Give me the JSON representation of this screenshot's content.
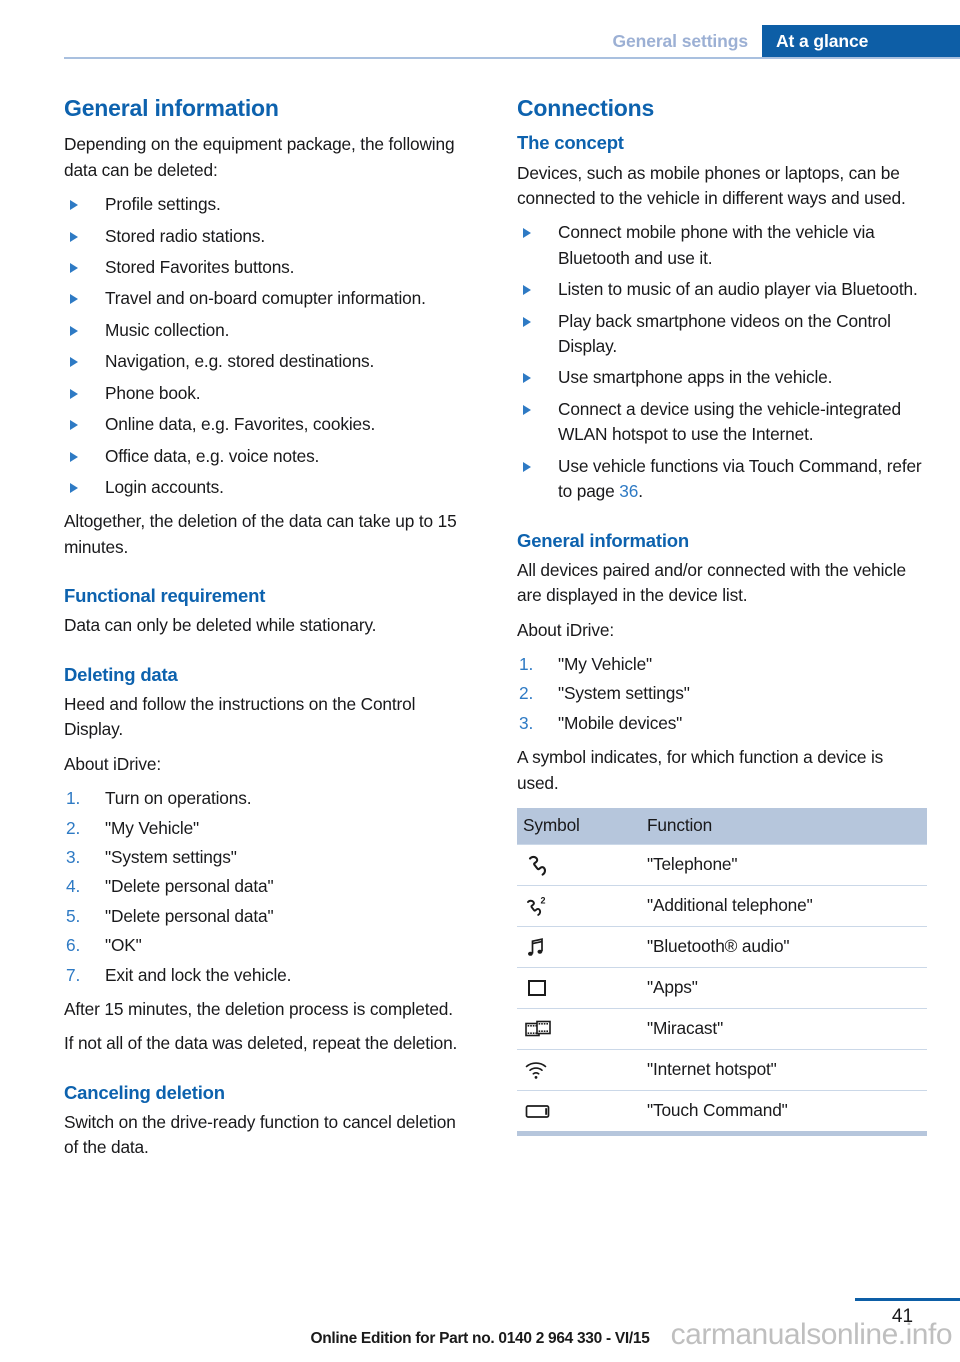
{
  "header": {
    "breadcrumb_inactive": "General settings",
    "breadcrumb_active": "At a glance"
  },
  "colors": {
    "accent_blue": "#0D5EA6",
    "heading_blue": "#0D62AE",
    "muted_blue": "#9CB0D4",
    "rule_blue": "#A9C0DF",
    "table_header_bg": "#B6C6DC",
    "table_divider": "#CBD8E8",
    "link_blue": "#2E7AC4"
  },
  "left_column": {
    "section_title": "General information",
    "intro": "Depending on the equipment package, the following data can be deleted:",
    "bullets": [
      "Profile settings.",
      "Stored radio stations.",
      "Stored Favorites buttons.",
      "Travel and on-board comupter information.",
      "Music collection.",
      "Navigation, e.g. stored destinations.",
      "Phone book.",
      "Online data, e.g. Favorites, cookies.",
      "Office data, e.g. voice notes.",
      "Login accounts."
    ],
    "after_bullets": "Altogether, the deletion of the data can take up to 15 minutes.",
    "functional_requirement": {
      "title": "Functional requirement",
      "text": "Data can only be deleted while stationary."
    },
    "deleting_data": {
      "title": "Deleting data",
      "text1": "Heed and follow the instructions on the Control Display.",
      "text2": "About iDrive:",
      "steps": [
        {
          "num": "1.",
          "label": "Turn on operations."
        },
        {
          "num": "2.",
          "label": "\"My Vehicle\""
        },
        {
          "num": "3.",
          "label": "\"System settings\""
        },
        {
          "num": "4.",
          "label": "\"Delete personal data\""
        },
        {
          "num": "5.",
          "label": "\"Delete personal data\""
        },
        {
          "num": "6.",
          "label": "\"OK\""
        },
        {
          "num": "7.",
          "label": "Exit and lock the vehicle."
        }
      ],
      "text3": "After 15 minutes, the deletion process is completed.",
      "text4": "If not all of the data was deleted, repeat the deletion."
    },
    "canceling_deletion": {
      "title": "Canceling deletion",
      "text": "Switch on the drive-ready function to cancel deletion of the data."
    }
  },
  "right_column": {
    "section_title": "Connections",
    "the_concept": {
      "title": "The concept",
      "text": "Devices, such as mobile phones or laptops, can be connected to the vehicle in different ways and used.",
      "bullets": [
        {
          "text": "Connect mobile phone with the vehicle via Bluetooth and use it."
        },
        {
          "text": "Listen to music of an audio player via Bluetooth."
        },
        {
          "text": "Play back smartphone videos on the Control Display."
        },
        {
          "text": "Use smartphone apps in the vehicle."
        },
        {
          "text": "Connect a device using the vehicle-integrated WLAN hotspot to use the Internet."
        },
        {
          "text_before": "Use vehicle functions via Touch Command, refer to page ",
          "page_ref": "36",
          "text_after": "."
        }
      ]
    },
    "general_information": {
      "title": "General information",
      "text1": "All devices paired and/or connected with the vehicle are displayed in the device list.",
      "text2": "About iDrive:",
      "steps": [
        {
          "num": "1.",
          "label": "\"My Vehicle\""
        },
        {
          "num": "2.",
          "label": "\"System settings\""
        },
        {
          "num": "3.",
          "label": "\"Mobile devices\""
        }
      ],
      "text3": "A symbol indicates, for which function a device is used."
    },
    "symbol_table": {
      "columns": [
        "Symbol",
        "Function"
      ],
      "rows": [
        {
          "icon": "telephone-handset-icon",
          "function": "\"Telephone\""
        },
        {
          "icon": "additional-telephone-icon",
          "function": "\"Additional telephone\""
        },
        {
          "icon": "music-note-icon",
          "function": "\"Bluetooth® audio\""
        },
        {
          "icon": "app-square-icon",
          "function": "\"Apps\""
        },
        {
          "icon": "film-strip-icon",
          "function": "\"Miracast\""
        },
        {
          "icon": "wifi-icon",
          "function": "\"Internet hotspot\""
        },
        {
          "icon": "touch-command-icon",
          "function": "\"Touch Command\""
        }
      ]
    }
  },
  "footer": {
    "page_number": "41",
    "edition_line": "Online Edition for Part no. 0140 2 964 330 - VI/15",
    "watermark": "carmanualsonline.info"
  }
}
